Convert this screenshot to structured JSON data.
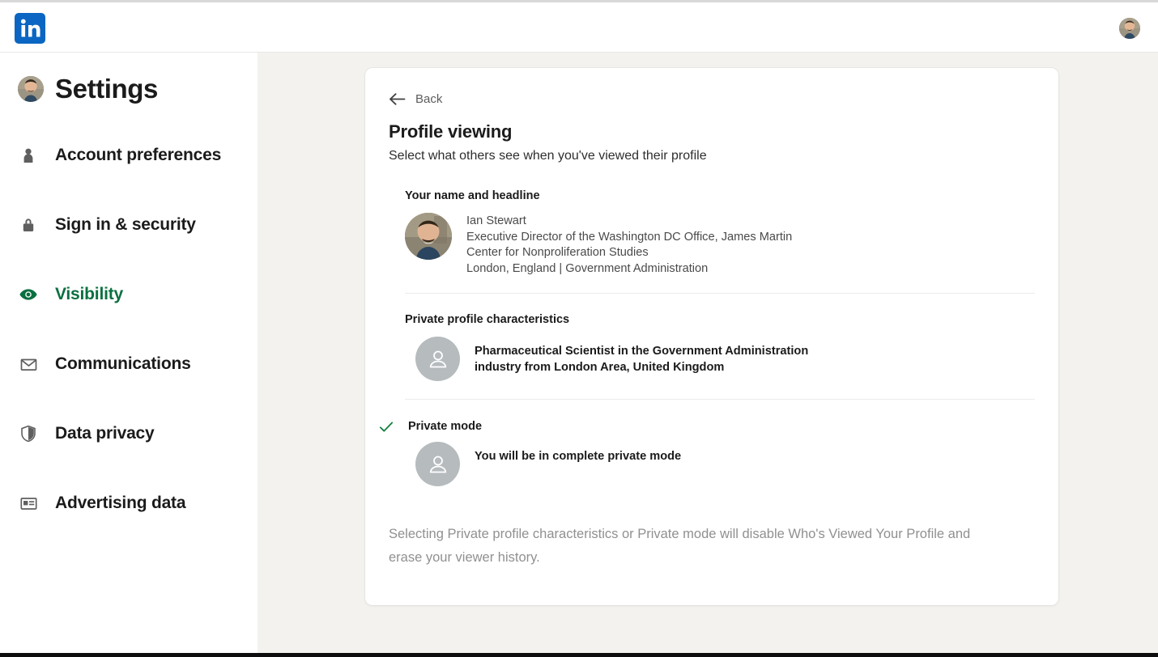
{
  "nav": {
    "logo_name": "linkedin-logo",
    "avatar_name": "nav-profile-avatar"
  },
  "sidebar": {
    "title": "Settings",
    "items": [
      {
        "label": "Account preferences",
        "icon": "person-icon",
        "active": false
      },
      {
        "label": "Sign in & security",
        "icon": "lock-icon",
        "active": false
      },
      {
        "label": "Visibility",
        "icon": "eye-icon",
        "active": true
      },
      {
        "label": "Communications",
        "icon": "envelope-icon",
        "active": false
      },
      {
        "label": "Data privacy",
        "icon": "shield-icon",
        "active": false
      },
      {
        "label": "Advertising data",
        "icon": "card-icon",
        "active": false
      }
    ]
  },
  "card": {
    "back_label": "Back",
    "title": "Profile viewing",
    "subtitle": "Select what others see when you've viewed their profile",
    "options": [
      {
        "label": "Your name and headline",
        "selected": false,
        "avatar_type": "photo",
        "lines": [
          "Ian Stewart",
          "Executive Director of the Washington DC Office, James Martin",
          "Center for Nonproliferation Studies",
          "London, England | Government Administration"
        ]
      },
      {
        "label": "Private profile characteristics",
        "selected": false,
        "avatar_type": "ghost",
        "lines": [
          "Pharmaceutical Scientist in the Government Administration",
          "industry from London Area, United Kingdom"
        ]
      },
      {
        "label": "Private mode",
        "selected": true,
        "avatar_type": "ghost",
        "lines": [
          "You will be in complete private mode"
        ]
      }
    ],
    "footer": "Selecting Private profile characteristics or Private mode will disable Who's Viewed Your Profile and erase your viewer history."
  },
  "colors": {
    "linkedin_blue": "#0a66c2",
    "active_green": "#0a7040",
    "check_green": "#15803d",
    "page_bg": "#f4f2ee"
  }
}
